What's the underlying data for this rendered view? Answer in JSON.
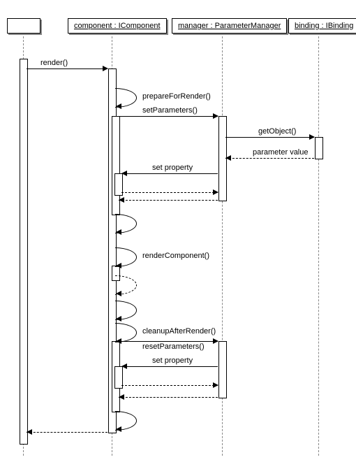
{
  "participants": {
    "p1": "",
    "p2": "component : IComponent",
    "p3": "manager : ParameterManager",
    "p4": "binding : IBinding"
  },
  "messages": {
    "render": "render()",
    "prepareForRender": "prepareForRender()",
    "setParameters": "setParameters()",
    "getObject": "getObject()",
    "paramValue": "parameter value",
    "setProperty1": "set property",
    "renderComponent": "renderComponent()",
    "cleanupAfterRender": "cleanupAfterRender()",
    "resetParameters": "resetParameters()",
    "setProperty2": "set property"
  },
  "chart_data": {
    "type": "sequence-diagram",
    "participants": [
      {
        "id": "actor",
        "name": ""
      },
      {
        "id": "component",
        "name": "component : IComponent"
      },
      {
        "id": "manager",
        "name": "manager : ParameterManager"
      },
      {
        "id": "binding",
        "name": "binding : IBinding"
      }
    ],
    "messages": [
      {
        "from": "actor",
        "to": "component",
        "label": "render()",
        "type": "sync"
      },
      {
        "from": "component",
        "to": "component",
        "label": "prepareForRender()",
        "type": "self"
      },
      {
        "from": "component",
        "to": "manager",
        "label": "setParameters()",
        "type": "sync"
      },
      {
        "from": "manager",
        "to": "binding",
        "label": "getObject()",
        "type": "sync"
      },
      {
        "from": "binding",
        "to": "manager",
        "label": "parameter value",
        "type": "return"
      },
      {
        "from": "manager",
        "to": "component",
        "label": "set property",
        "type": "sync"
      },
      {
        "from": "component",
        "to": "manager",
        "label": "",
        "type": "return"
      },
      {
        "from": "manager",
        "to": "component",
        "label": "",
        "type": "return"
      },
      {
        "from": "component",
        "to": "component",
        "label": "",
        "type": "self"
      },
      {
        "from": "component",
        "to": "component",
        "label": "renderComponent()",
        "type": "self"
      },
      {
        "from": "component",
        "to": "component",
        "label": "",
        "type": "self-return"
      },
      {
        "from": "component",
        "to": "component",
        "label": "",
        "type": "self"
      },
      {
        "from": "component",
        "to": "component",
        "label": "cleanupAfterRender()",
        "type": "self"
      },
      {
        "from": "component",
        "to": "manager",
        "label": "resetParameters()",
        "type": "sync"
      },
      {
        "from": "manager",
        "to": "component",
        "label": "set property",
        "type": "sync"
      },
      {
        "from": "component",
        "to": "manager",
        "label": "",
        "type": "return"
      },
      {
        "from": "manager",
        "to": "component",
        "label": "",
        "type": "return"
      },
      {
        "from": "component",
        "to": "component",
        "label": "",
        "type": "self"
      },
      {
        "from": "component",
        "to": "actor",
        "label": "",
        "type": "return"
      }
    ]
  }
}
